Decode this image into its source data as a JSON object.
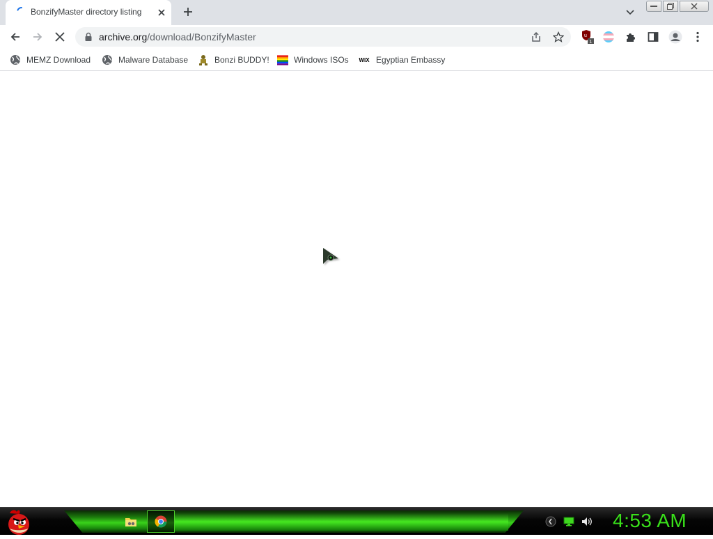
{
  "tab": {
    "title": "BonzifyMaster directory listing",
    "favicon": "archive-icon"
  },
  "toolbar": {
    "back_icon": "back-arrow-icon",
    "forward_icon": "forward-arrow-icon",
    "stop_icon": "stop-loading-icon",
    "url_host": "archive.org",
    "url_path": "/download/BonzifyMaster",
    "extension_badge": "1"
  },
  "bookmarks": [
    {
      "label": "MEMZ Download",
      "icon": "globe-icon"
    },
    {
      "label": "Malware Database",
      "icon": "globe-icon"
    },
    {
      "label": "Bonzi BUDDY!",
      "icon": "bonzi-icon"
    },
    {
      "label": "Windows ISOs",
      "icon": "rainbow-flag-icon"
    },
    {
      "label": "Egyptian Embassy",
      "icon": "wix-icon",
      "icon_text": "WIX"
    }
  ],
  "taskbar": {
    "start_icon": "angry-bird-icon",
    "apps": [
      {
        "name": "file-explorer",
        "active": false
      },
      {
        "name": "chrome",
        "active": true
      }
    ],
    "clock": "4:53 AM"
  },
  "colors": {
    "tabstrip_bg": "#dee1e6",
    "omnibox_bg": "#f1f3f4",
    "taskbar_green": "#39e01a"
  }
}
